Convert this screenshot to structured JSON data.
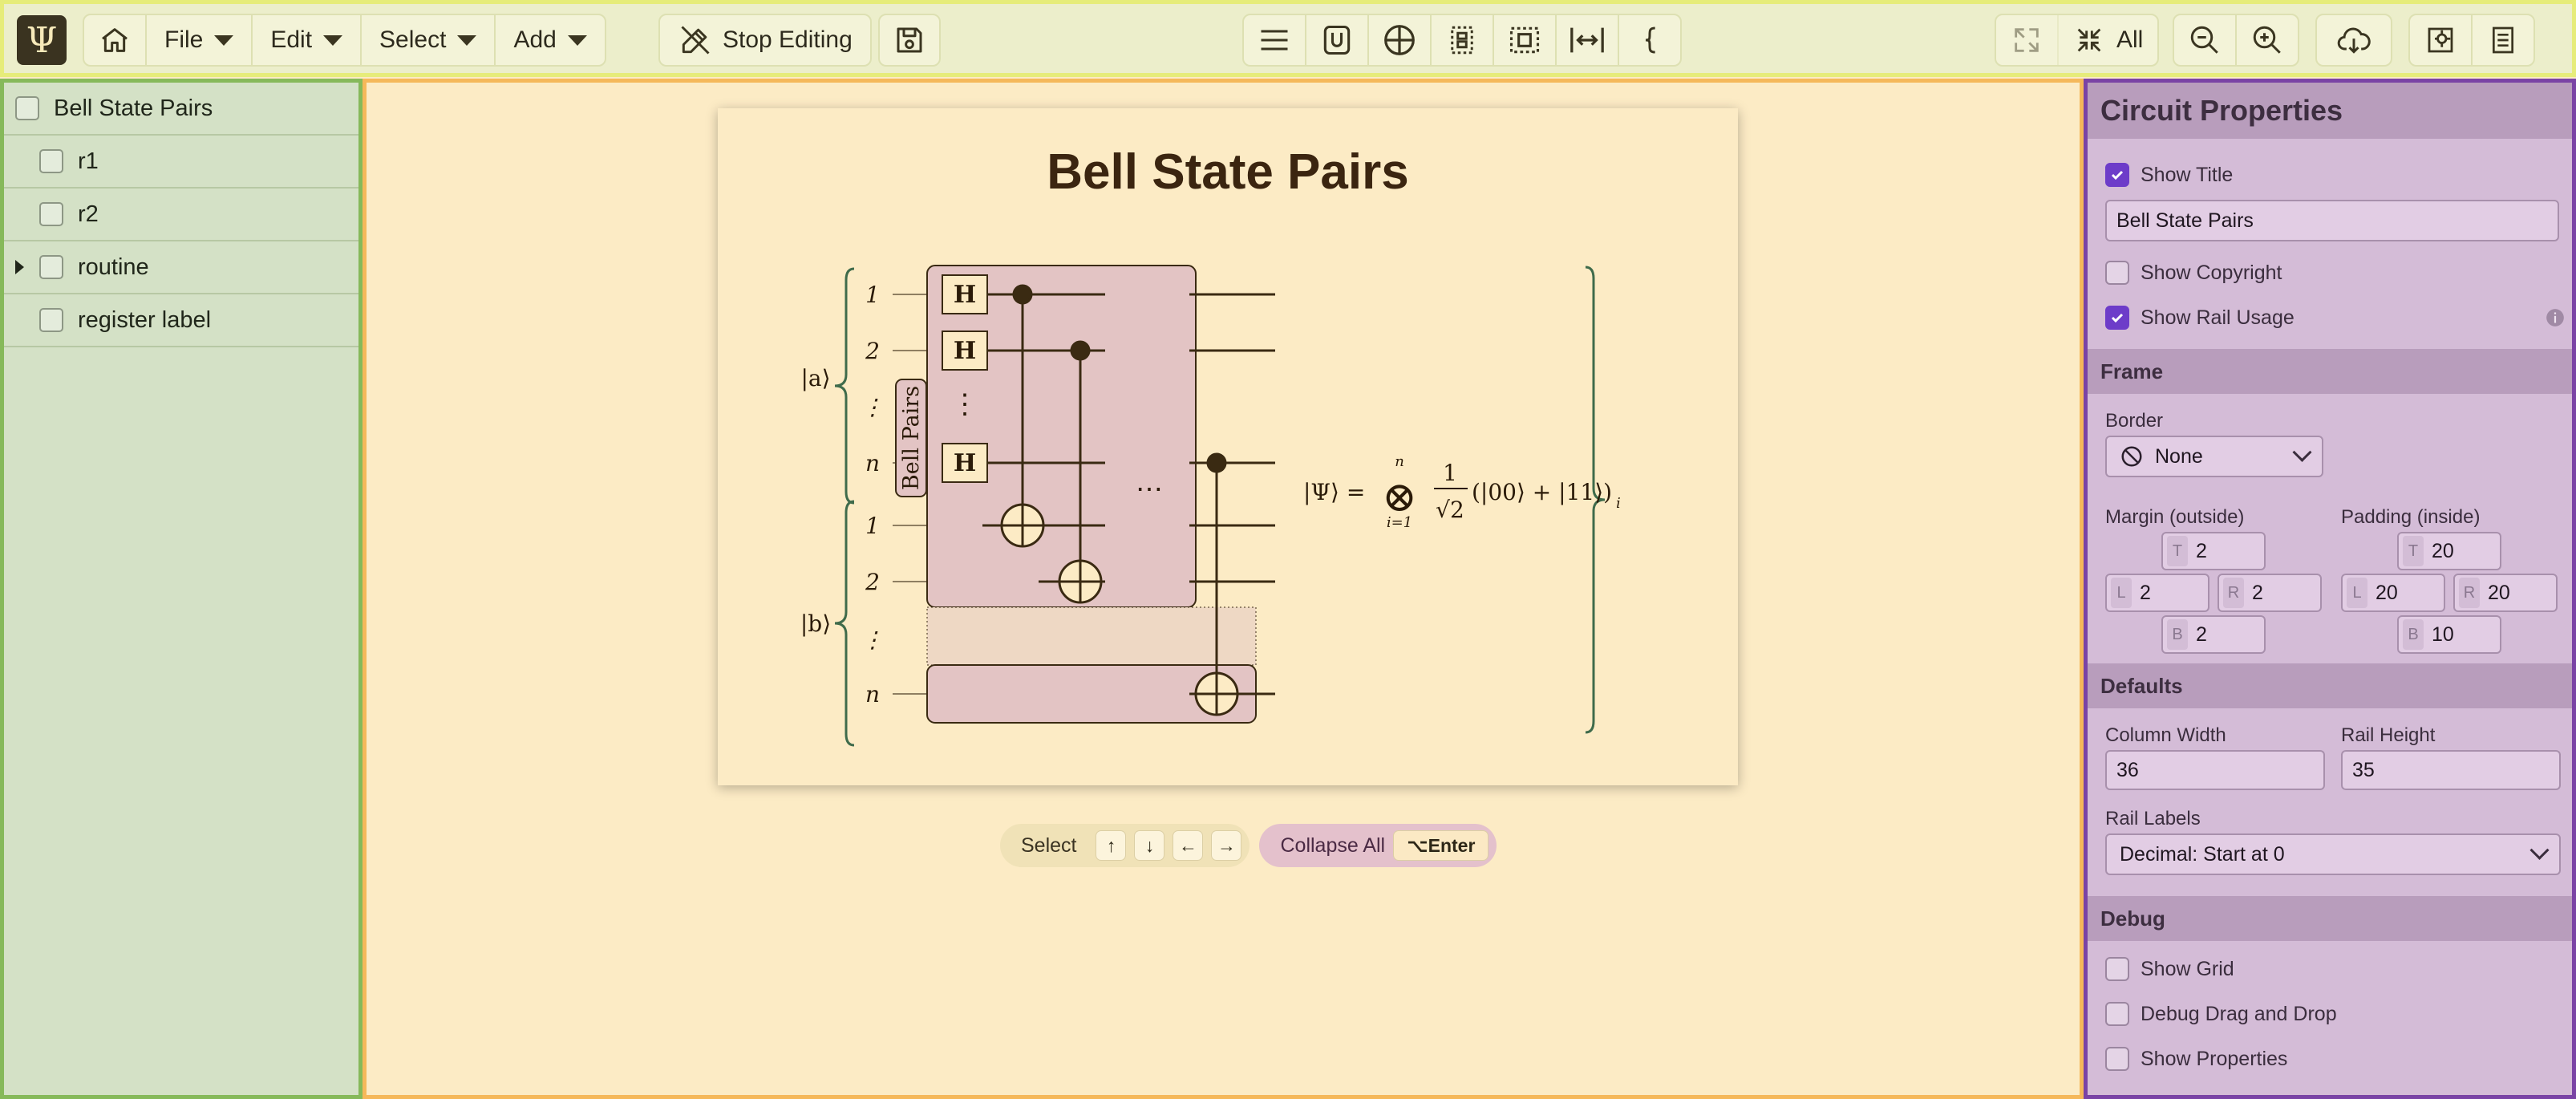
{
  "toolbar": {
    "logo_glyph": "Ψ",
    "menus": [
      {
        "label": "File"
      },
      {
        "label": "Edit"
      },
      {
        "label": "Select"
      },
      {
        "label": "Add"
      }
    ],
    "stop_editing_label": "Stop Editing",
    "all_label": "All",
    "icons": [
      "home-icon",
      "pencil-off-icon",
      "save-icon",
      "list-icon",
      "union-icon",
      "circle-plus-icon",
      "grid-dots-icon",
      "box-select-icon",
      "arrows-horizontal-icon",
      "brace-icon",
      "expand-icon",
      "collapse-icon",
      "zoom-out-icon",
      "zoom-in-icon",
      "cloud-download-icon",
      "settings-panel-icon",
      "document-icon"
    ]
  },
  "outline": {
    "items": [
      {
        "label": "Bell State Pairs",
        "depth": 0,
        "expandable": false
      },
      {
        "label": "r1",
        "depth": 1,
        "expandable": false
      },
      {
        "label": "r2",
        "depth": 1,
        "expandable": false
      },
      {
        "label": "routine",
        "depth": 1,
        "expandable": true
      },
      {
        "label": "register label",
        "depth": 1,
        "expandable": false
      }
    ]
  },
  "canvas": {
    "title": "Bell State Pairs",
    "circuit": {
      "group_a_label": "|a⟩",
      "group_b_label": "|b⟩",
      "rail_labels_a": [
        "1",
        "2",
        "⋮",
        "n"
      ],
      "rail_labels_b": [
        "1",
        "2",
        "⋮",
        "n"
      ],
      "routine_label": "Bell Pairs",
      "gate_label": "H",
      "ellipsis": "⋯",
      "vdots": "⋮",
      "formula": {
        "lhs": "|Ψ⟩ =",
        "op": "⊗",
        "upper": "n",
        "lower": "i=1",
        "num": "1",
        "den": "√2",
        "body": "(|00⟩ + |11⟩)",
        "subscript": "i"
      }
    },
    "hints": {
      "select_label": "Select",
      "keys": [
        "↑",
        "↓",
        "←",
        "→"
      ],
      "collapse_label": "Collapse All",
      "collapse_key": "⌥Enter"
    }
  },
  "props": {
    "title": "Circuit Properties",
    "show_title": {
      "label": "Show Title",
      "checked": true
    },
    "title_value": "Bell State Pairs",
    "show_copyright": {
      "label": "Show Copyright",
      "checked": false
    },
    "show_rail_usage": {
      "label": "Show Rail Usage",
      "checked": true
    },
    "frame": {
      "header": "Frame",
      "border_label": "Border",
      "border_value": "None",
      "margin_label": "Margin (outside)",
      "padding_label": "Padding (inside)",
      "margin": {
        "T": "2",
        "L": "2",
        "R": "2",
        "B": "2"
      },
      "padding": {
        "T": "20",
        "L": "20",
        "R": "20",
        "B": "10"
      },
      "tags": {
        "T": "T",
        "L": "L",
        "R": "R",
        "B": "B"
      }
    },
    "defaults": {
      "header": "Defaults",
      "column_width_label": "Column Width",
      "column_width": "36",
      "rail_height_label": "Rail Height",
      "rail_height": "35",
      "rail_labels_label": "Rail Labels",
      "rail_labels_value": "Decimal: Start at 0"
    },
    "debug": {
      "header": "Debug",
      "items": [
        {
          "label": "Show Grid",
          "checked": false
        },
        {
          "label": "Debug Drag and Drop",
          "checked": false
        },
        {
          "label": "Show Properties",
          "checked": false
        }
      ]
    }
  },
  "colors": {
    "toolbar_bg": "#eceecb",
    "outline_bg": "#d4e1c6",
    "canvas_bg": "#fcebc5",
    "props_bg": "#d4bcd7",
    "accent_purple": "#6d3cc9",
    "brace_green": "#3f6b4b",
    "circuit_ink": "#3a2a12"
  }
}
